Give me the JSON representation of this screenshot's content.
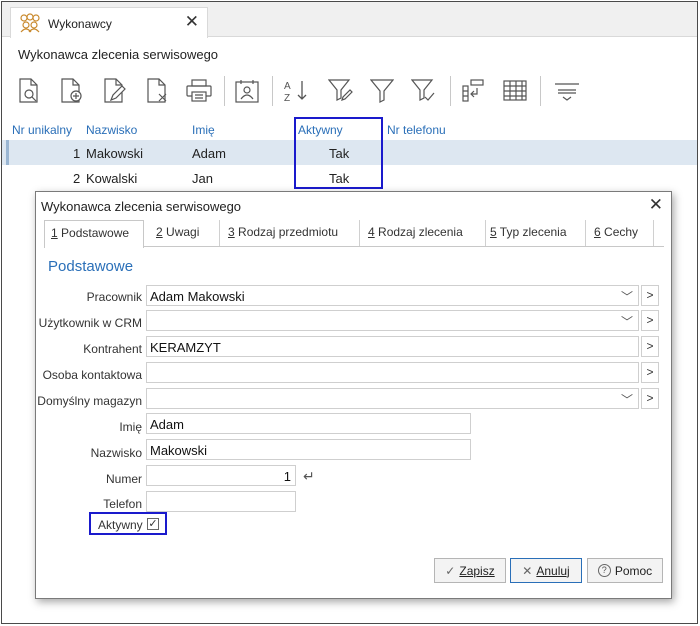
{
  "tab": {
    "title": "Wykonawcy",
    "close": "✕"
  },
  "window_title": "Wykonawca zlecenia serwisowego",
  "toolbar": {
    "buttons": [
      "view-document",
      "add-document",
      "edit-document",
      "delete-document",
      "print",
      "contact-card",
      "sort-az",
      "filter-edit",
      "filter",
      "filter-clear",
      "columns-layout",
      "grid-table",
      "group-rows"
    ]
  },
  "grid": {
    "headers": {
      "nr": "Nr unikalny",
      "nazwisko": "Nazwisko",
      "imie": "Imię",
      "aktywny": "Aktywny",
      "telefon": "Nr telefonu"
    },
    "rows": [
      {
        "nr": "1",
        "nazwisko": "Makowski",
        "imie": "Adam",
        "aktywny": "Tak"
      },
      {
        "nr": "2",
        "nazwisko": "Kowalski",
        "imie": "Jan",
        "aktywny": "Tak"
      }
    ]
  },
  "dialog": {
    "title": "Wykonawca zlecenia serwisowego",
    "close": "✕",
    "tabs": [
      {
        "num": "1",
        "label": " Podstawowe"
      },
      {
        "num": "2",
        "label": " Uwagi"
      },
      {
        "num": "3",
        "label": " Rodzaj przedmiotu"
      },
      {
        "num": "4",
        "label": " Rodzaj zlecenia"
      },
      {
        "num": "5",
        "label": " Typ zlecenia"
      },
      {
        "num": "6",
        "label": " Cechy"
      }
    ],
    "section_title": "Podstawowe",
    "fields": {
      "pracownik": {
        "label": "Pracownik",
        "value": "Adam Makowski"
      },
      "uzytkownik": {
        "label": "Użytkownik w CRM",
        "value": ""
      },
      "kontrahent": {
        "label": "Kontrahent",
        "value": "KERAMZYT"
      },
      "osoba": {
        "label": "Osoba kontaktowa",
        "value": ""
      },
      "magazyn": {
        "label": "Domyślny magazyn",
        "value": ""
      },
      "imie": {
        "label": "Imię",
        "value": "Adam"
      },
      "nazwisko": {
        "label": "Nazwisko",
        "value": "Makowski"
      },
      "numer": {
        "label": "Numer",
        "value": "1"
      },
      "telefon": {
        "label": "Telefon",
        "value": ""
      },
      "aktywny": {
        "label": "Aktywny",
        "checked": true
      }
    },
    "buttons": {
      "zapisz": {
        "icon": "✓",
        "label": "Zapisz"
      },
      "anuluj": {
        "icon": "✕",
        "label": "Anuluj"
      },
      "pomoc": {
        "icon": "?",
        "label": "Pomoc"
      }
    }
  },
  "colors": {
    "accent": "#2a6fb8",
    "highlight": "#1a1acc",
    "selected_row": "#dde7f1"
  }
}
